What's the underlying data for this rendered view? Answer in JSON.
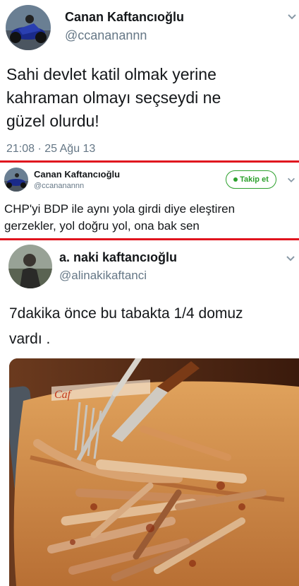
{
  "tweet1": {
    "name": "Canan Kaftancıoğlu",
    "handle": "@ccananannn",
    "text_lines": [
      "Sahi devlet katil olmak yerine",
      "kahraman olmayı seçseydi ne",
      "güzel olurdu!"
    ],
    "timestamp": "21:08 · 25 Ağu 13"
  },
  "tweet2": {
    "name": "Canan Kaftancıoğlu",
    "handle": "@ccananannn",
    "follow_label": "Takip et",
    "text_lines": [
      "CHP'yi BDP ile aynı yola girdi diye eleştiren",
      "gerzekler, yol doğru yol, ona bak sen"
    ]
  },
  "tweet3": {
    "name": "a. naki kaftancıoğlu",
    "handle": "@alinakikaftanci",
    "text_lines": [
      "7dakika önce bu tabakta 1/4 domuz",
      "vardı ."
    ],
    "photo_alt": "Plate of bones with fork and knife"
  },
  "icons": {
    "chevron": "chevron-down-icon",
    "follow": "follow-bird-icon"
  },
  "colors": {
    "separator": "#e0141e",
    "follow_green": "#2ca02c",
    "handle_gray": "#657786"
  }
}
